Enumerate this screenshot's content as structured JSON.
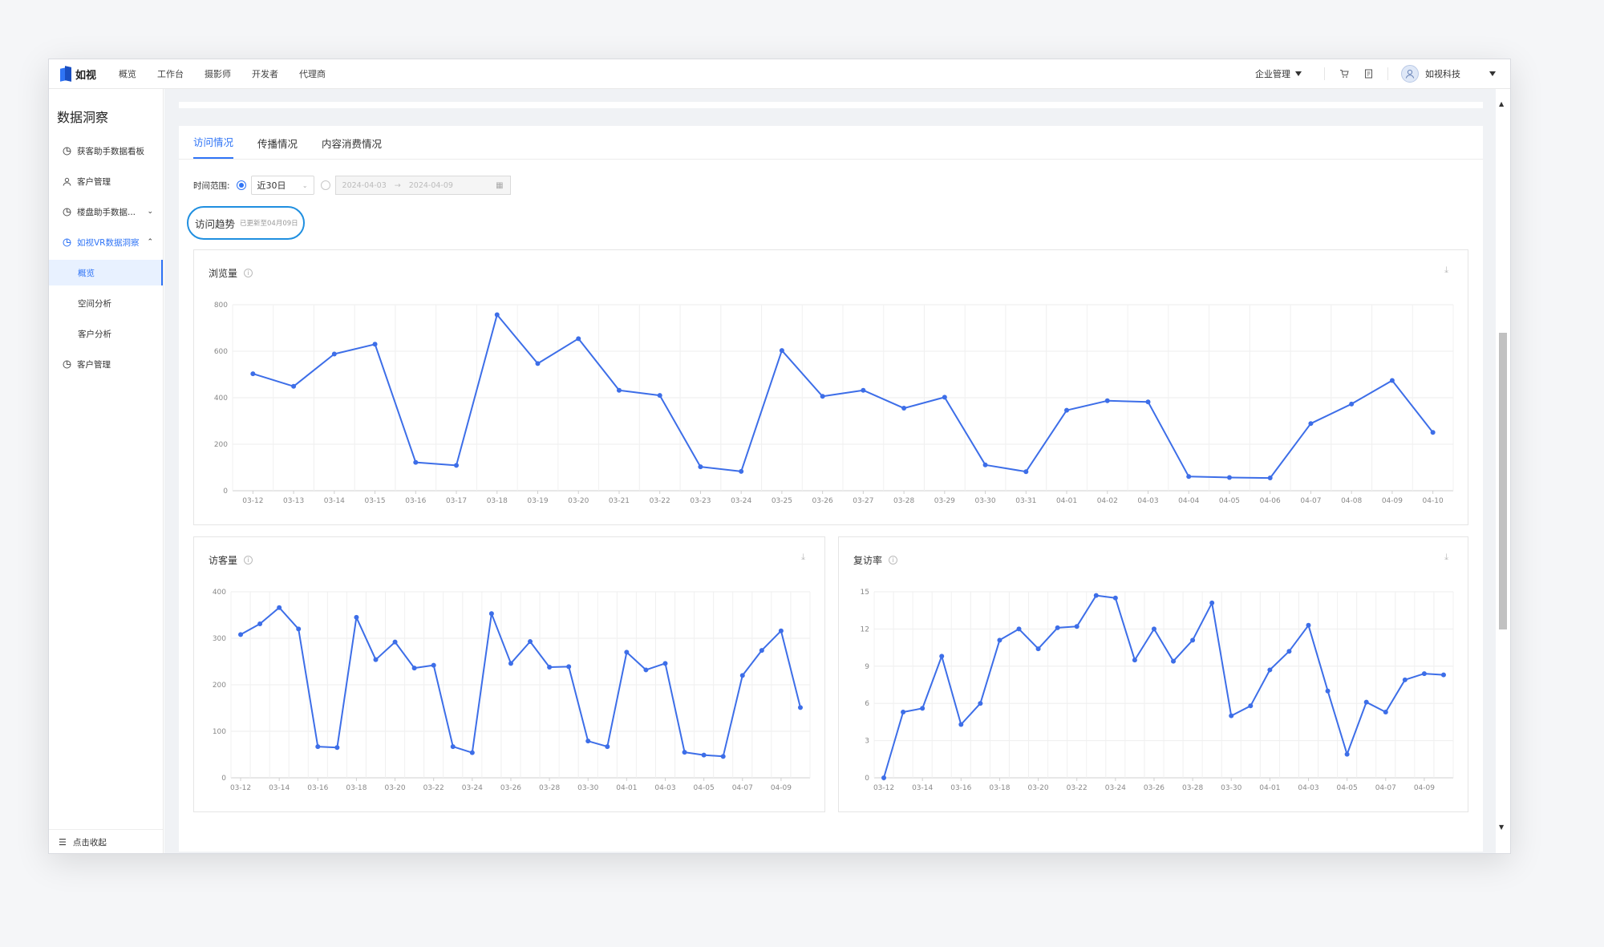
{
  "app": {
    "logo_text": "如视"
  },
  "topnav": [
    "概览",
    "工作台",
    "摄影师",
    "开发者",
    "代理商"
  ],
  "topright": {
    "enterprise": "企业管理",
    "cart_icon": "cart-icon",
    "doc_icon": "document-icon",
    "user_name": "如视科技"
  },
  "sidebar": {
    "title": "数据洞察",
    "items": [
      {
        "label": "获客助手数据看板",
        "icon": "chart-icon"
      },
      {
        "label": "客户管理",
        "icon": "user-icon"
      },
      {
        "label": "楼盘助手数据...",
        "icon": "chart-icon",
        "chevron": "⌄"
      },
      {
        "label": "如视VR数据洞察",
        "icon": "chart-icon",
        "chevron": "⌃"
      }
    ],
    "subitems": [
      "概览",
      "空间分析",
      "客户分析"
    ],
    "last_item": {
      "label": "客户管理",
      "icon": "chart-icon"
    },
    "collapse_label": "点击收起"
  },
  "tabs": [
    "访问情况",
    "传播情况",
    "内容消费情况"
  ],
  "filter": {
    "label": "时间范围:",
    "select_value": "近30日",
    "range_start": "2024-04-03",
    "range_arrow": "→",
    "range_end": "2024-04-09"
  },
  "trend": {
    "title": "访问趋势",
    "subtitle": "已更新至04月09日"
  },
  "colors": {
    "accent": "#2f74f6",
    "line": "#3d6ee8"
  },
  "chart_data": [
    {
      "type": "line",
      "title": "浏览量",
      "x": [
        "03-12",
        "03-13",
        "03-14",
        "03-15",
        "03-16",
        "03-17",
        "03-18",
        "03-19",
        "03-20",
        "03-21",
        "03-22",
        "03-23",
        "03-24",
        "03-25",
        "03-26",
        "03-27",
        "03-28",
        "03-29",
        "03-30",
        "03-31",
        "04-01",
        "04-02",
        "04-03",
        "04-04",
        "04-05",
        "04-06",
        "04-07",
        "04-08",
        "04-09",
        "04-10"
      ],
      "x_tick_labels": [
        "03-12",
        "03-13",
        "03-14",
        "03-15",
        "03-16",
        "03-17",
        "03-18",
        "03-19",
        "03-20",
        "03-21",
        "03-22",
        "03-23",
        "03-24",
        "03-25",
        "03-26",
        "03-27",
        "03-28",
        "03-29",
        "03-30",
        "03-31",
        "04-01",
        "04-02",
        "04-03",
        "04-04",
        "04-05",
        "04-06",
        "04-07",
        "04-08",
        "04-09",
        "04-10"
      ],
      "values": [
        503,
        449,
        588,
        630,
        122,
        109,
        757,
        547,
        654,
        432,
        410,
        103,
        83,
        603,
        406,
        432,
        355,
        402,
        111,
        82,
        346,
        387,
        382,
        61,
        57,
        55,
        289,
        373,
        474,
        251
      ],
      "yticks": [
        0,
        200,
        400,
        600,
        800
      ],
      "ylim": [
        0,
        800
      ],
      "grid": true
    },
    {
      "type": "line",
      "title": "访客量",
      "x": [
        "03-12",
        "03-13",
        "03-14",
        "03-15",
        "03-16",
        "03-17",
        "03-18",
        "03-19",
        "03-20",
        "03-21",
        "03-22",
        "03-23",
        "03-24",
        "03-25",
        "03-26",
        "03-27",
        "03-28",
        "03-29",
        "03-30",
        "03-31",
        "04-01",
        "04-02",
        "04-03",
        "04-04",
        "04-05",
        "04-06",
        "04-07",
        "04-08",
        "04-09",
        "04-10"
      ],
      "x_tick_labels": [
        "03-12",
        "03-14",
        "03-16",
        "03-18",
        "03-20",
        "03-22",
        "03-24",
        "03-26",
        "03-28",
        "03-30",
        "04-01",
        "04-03",
        "04-05",
        "04-07",
        "04-09"
      ],
      "values": [
        308,
        331,
        366,
        320,
        67,
        65,
        345,
        254,
        292,
        236,
        242,
        67,
        54,
        353,
        246,
        293,
        238,
        239,
        79,
        67,
        270,
        232,
        246,
        55,
        49,
        46,
        220,
        274,
        316,
        151
      ],
      "yticks": [
        0,
        100,
        200,
        300,
        400
      ],
      "ylim": [
        0,
        400
      ],
      "grid": true
    },
    {
      "type": "line",
      "title": "复访率",
      "x": [
        "03-12",
        "03-13",
        "03-14",
        "03-15",
        "03-16",
        "03-17",
        "03-18",
        "03-19",
        "03-20",
        "03-21",
        "03-22",
        "03-23",
        "03-24",
        "03-25",
        "03-26",
        "03-27",
        "03-28",
        "03-29",
        "03-30",
        "03-31",
        "04-01",
        "04-02",
        "04-03",
        "04-04",
        "04-05",
        "04-06",
        "04-07",
        "04-08",
        "04-09",
        "04-10"
      ],
      "x_tick_labels": [
        "03-12",
        "03-14",
        "03-16",
        "03-18",
        "03-20",
        "03-22",
        "03-24",
        "03-26",
        "03-28",
        "03-30",
        "04-01",
        "04-03",
        "04-05",
        "04-07",
        "04-09"
      ],
      "values": [
        0,
        5.3,
        5.6,
        9.8,
        4.3,
        6.0,
        11.1,
        12.0,
        10.4,
        12.1,
        12.2,
        14.7,
        14.5,
        9.5,
        12.0,
        9.4,
        11.1,
        14.1,
        5.0,
        5.8,
        8.7,
        10.2,
        12.3,
        7.0,
        1.9,
        6.1,
        5.3,
        7.9,
        8.4,
        8.3
      ],
      "yticks": [
        0,
        3,
        6,
        9,
        12,
        15
      ],
      "ylim": [
        0,
        15
      ],
      "grid": true
    }
  ]
}
